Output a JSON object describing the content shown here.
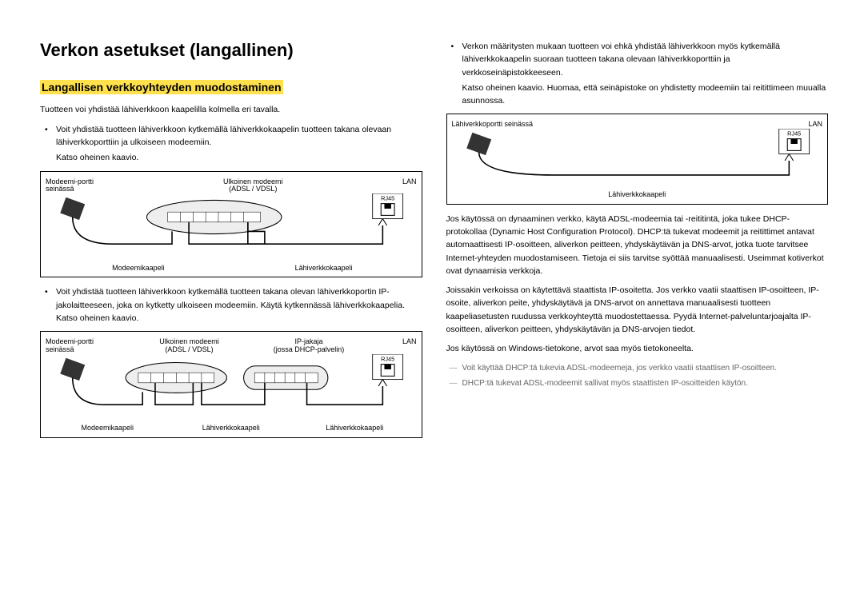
{
  "title": "Verkon asetukset (langallinen)",
  "subtitle": "Langallisen verkkoyhteyden muodostaminen",
  "intro": "Tuotteen voi yhdistää lähiverkkoon kaapelilla kolmella eri tavalla.",
  "bullets_left": {
    "b1": "Voit yhdistää tuotteen lähiverkkoon kytkemällä lähiverkkokaapelin tuotteen takana olevaan lähiverkkoporttiin ja ulkoiseen modeemiin.",
    "b1_after": "Katso oheinen kaavio.",
    "b2": "Voit yhdistää tuotteen lähiverkkoon kytkemällä tuotteen takana olevan lähiverkkoportin IP-jakolaitteeseen, joka on kytketty ulkoiseen modeemiin. Käytä kytkennässä lähiverkkokaapelia. Katso oheinen kaavio."
  },
  "diagram1": {
    "modeemi_port": "Modeemi-portti seinässä",
    "ext_modem": "Ulkoinen modeemi",
    "ext_modem_sub": "(ADSL / VDSL)",
    "lan": "LAN",
    "rj45": "RJ45",
    "modeemikaapeli": "Modeemikaapeli",
    "lahiverkkokaapeli": "Lähiverkkokaapeli"
  },
  "diagram2": {
    "modeemi_port": "Modeemi-portti seinässä",
    "ext_modem": "Ulkoinen modeemi",
    "ext_modem_sub": "(ADSL / VDSL)",
    "ipjakaja": "IP-jakaja",
    "ipjakaja_sub": "(jossa DHCP-palvelin)",
    "lan": "LAN",
    "rj45": "RJ45",
    "modeemikaapeli": "Modeemikaapeli",
    "lahi1": "Lähiverkkokaapeli",
    "lahi2": "Lähiverkkokaapeli"
  },
  "right_bullet": {
    "text": "Verkon määritysten mukaan tuotteen voi ehkä yhdistää lähiverkkoon myös kytkemällä lähiverkkokaapelin suoraan tuotteen takana olevaan lähiverkkoporttiin ja verkkoseinäpistokkeeseen.",
    "after": "Katso oheinen kaavio. Huomaa, että seinäpistoke on yhdistetty modeemiin tai reitittimeen muualla asunnossa."
  },
  "diagram3": {
    "port": "Lähiverkkoportti seinässä",
    "lan": "LAN",
    "rj45": "RJ45",
    "cable": "Lähiverkkokaapeli"
  },
  "para1": "Jos käytössä on dynaaminen verkko, käytä ADSL-modeemia tai -reititintä, joka tukee DHCP-protokollaa (Dynamic Host Configuration Protocol). DHCP:tä tukevat modeemit ja reitittimet antavat automaattisesti IP-osoitteen, aliverkon peitteen, yhdyskäytävän ja DNS-arvot, jotka tuote tarvitsee Internet-yhteyden muodostamiseen. Tietoja ei siis tarvitse syöttää manuaalisesti. Useimmat kotiverkot ovat dynaamisia verkkoja.",
  "para2": "Joissakin verkoissa on käytettävä staattista IP-osoitetta. Jos verkko vaatii staattisen IP-osoitteen, IP-osoite, aliverkon peite, yhdyskäytävä ja DNS-arvot on annettava manuaalisesti tuotteen kaapeliasetusten ruudussa verkkoyhteyttä muodostettaessa. Pyydä Internet-palveluntarjoajalta IP-osoitteen, aliverkon peitteen, yhdyskäytävän ja DNS-arvojen tiedot.",
  "para3": "Jos käytössä on Windows-tietokone, arvot saa myös tietokoneelta.",
  "note1": "Voit käyttää DHCP:tä tukevia ADSL-modeemeja, jos verkko vaatii staattisen IP-osoitteen.",
  "note2": "DHCP:tä tukevat ADSL-modeemit sallivat myös staattisten IP-osoitteiden käytön."
}
